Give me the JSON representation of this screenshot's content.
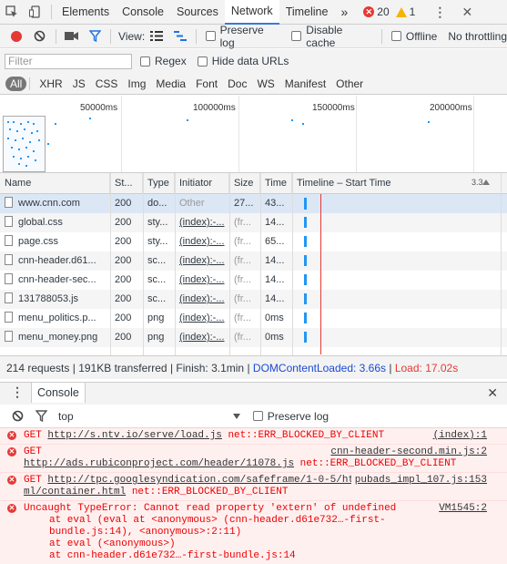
{
  "tabs": {
    "items": [
      "Elements",
      "Console",
      "Sources",
      "Network",
      "Timeline"
    ],
    "active": "Network",
    "more": "»",
    "errors": "20",
    "warnings": "1",
    "menu": "⋮",
    "close": "✕"
  },
  "toolbar": {
    "view_label": "View:",
    "preserve_log": "Preserve log",
    "disable_cache": "Disable cache",
    "offline": "Offline",
    "throttle": "No throttling"
  },
  "filter": {
    "placeholder": "Filter",
    "regex": "Regex",
    "hide_data": "Hide data URLs"
  },
  "types": [
    "All",
    "XHR",
    "JS",
    "CSS",
    "Img",
    "Media",
    "Font",
    "Doc",
    "WS",
    "Manifest",
    "Other"
  ],
  "overview": {
    "ticks": [
      "50000ms",
      "100000ms",
      "150000ms",
      "200000ms"
    ]
  },
  "table": {
    "headers": {
      "name": "Name",
      "status": "St...",
      "type": "Type",
      "initiator": "Initiator",
      "size": "Size",
      "time": "Time",
      "timeline": "Timeline – Start Time",
      "timeline_right": "3.3"
    },
    "rows": [
      {
        "name": "www.cnn.com",
        "status": "200",
        "type": "do...",
        "initiator": "Other",
        "size": "27...",
        "time": "43..."
      },
      {
        "name": "global.css",
        "status": "200",
        "type": "sty...",
        "initiator": "(index):-...",
        "size": "(fr...",
        "time": "14..."
      },
      {
        "name": "page.css",
        "status": "200",
        "type": "sty...",
        "initiator": "(index):-...",
        "size": "(fr...",
        "time": "65..."
      },
      {
        "name": "cnn-header.d61...",
        "status": "200",
        "type": "sc...",
        "initiator": "(index):-...",
        "size": "(fr...",
        "time": "14..."
      },
      {
        "name": "cnn-header-sec...",
        "status": "200",
        "type": "sc...",
        "initiator": "(index):-...",
        "size": "(fr...",
        "time": "14..."
      },
      {
        "name": "131788053.js",
        "status": "200",
        "type": "sc...",
        "initiator": "(index):-...",
        "size": "(fr...",
        "time": "14..."
      },
      {
        "name": "menu_politics.p...",
        "status": "200",
        "type": "png",
        "initiator": "(index):-...",
        "size": "(fr...",
        "time": "0ms"
      },
      {
        "name": "menu_money.png",
        "status": "200",
        "type": "png",
        "initiator": "(index):-...",
        "size": "(fr...",
        "time": "0ms"
      }
    ]
  },
  "status": {
    "requests": "214 requests",
    "transferred": "191KB transferred",
    "finish": "Finish: 3.1min",
    "dom": "DOMContentLoaded: 3.66s",
    "load": "Load: 17.02s"
  },
  "drawer": {
    "tab": "Console",
    "context": "top",
    "preserve_log": "Preserve log"
  },
  "console": {
    "messages": [
      {
        "prefix": "GET ",
        "url": "http://s.ntv.io/serve/load.js",
        "error": " net::ERR_BLOCKED_BY_CLIENT",
        "source": "(index):1"
      },
      {
        "prefix": "GET ",
        "url": "http://ads.rubiconproject.com/header/11078.js",
        "error": " net::ERR_BLOCKED_BY_CLIENT",
        "source": "cnn-header-second.min.js:2"
      },
      {
        "prefix": "GET ",
        "url": "http://tpc.googlesyndication.com/safeframe/1-0-5/html/container.html",
        "error": " net::ERR_BLOCKED_BY_CLIENT",
        "source": "pubads_impl_107.js:153"
      },
      {
        "prefix": "Uncaught TypeError: Cannot read property 'extern' of undefined",
        "url": "",
        "error": "",
        "source": "VM1545:2"
      }
    ],
    "stack": [
      "at eval (eval at <anonymous> (cnn-header.d61e732…-first-bundle.js:14), <anonymous>:2:11)",
      "at eval (<anonymous>)",
      "at cnn-header.d61e732…-first-bundle.js:14"
    ]
  }
}
